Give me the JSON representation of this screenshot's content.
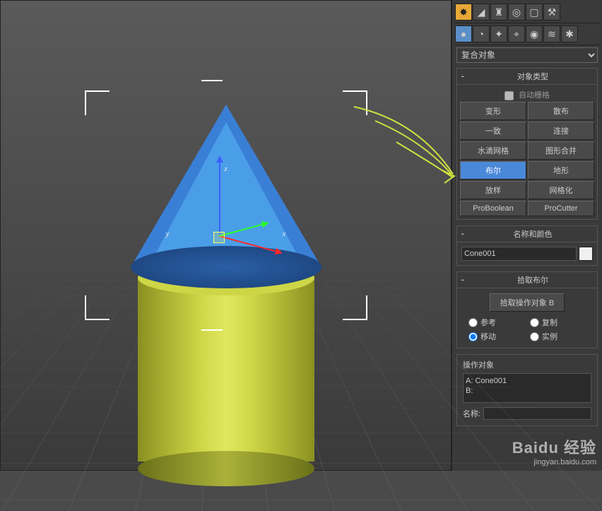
{
  "viewport": {
    "object_a_type": "cone",
    "object_b_type": "cylinder",
    "axis_labels": {
      "x": "x",
      "y": "y",
      "z": "z"
    }
  },
  "toolbar_top": {
    "icons": [
      "sun",
      "arc",
      "rig",
      "target",
      "display",
      "hammer"
    ]
  },
  "toolbar_sub": {
    "icons": [
      "sphere",
      "shapes",
      "light",
      "camera",
      "helper",
      "wave",
      "fx"
    ]
  },
  "dropdown": {
    "value": "复合对象"
  },
  "rollouts": {
    "object_type": {
      "title": "对象类型",
      "auto_grid": "自动栅格",
      "buttons": [
        {
          "label": "变形"
        },
        {
          "label": "散布"
        },
        {
          "label": "一致"
        },
        {
          "label": "连接"
        },
        {
          "label": "水滴网格"
        },
        {
          "label": "图形合并"
        },
        {
          "label": "布尔",
          "selected": true
        },
        {
          "label": "地形"
        },
        {
          "label": "放样"
        },
        {
          "label": "网格化"
        },
        {
          "label": "ProBoolean"
        },
        {
          "label": "ProCutter"
        }
      ]
    },
    "name_color": {
      "title": "名称和颜色",
      "name_value": "Cone001"
    },
    "pick_boolean": {
      "title": "拾取布尔",
      "pick_button": "拾取操作对象 B",
      "radios": {
        "reference": "参考",
        "copy": "复制",
        "move": "移动",
        "instance": "实例"
      },
      "selected_radio": "move"
    },
    "operands": {
      "title": "操作对象",
      "list": [
        "A: Cone001",
        "B:"
      ],
      "name_label": "名称:"
    }
  },
  "watermark": {
    "brand": "Baidu 经验",
    "url": "jingyan.baidu.com"
  }
}
